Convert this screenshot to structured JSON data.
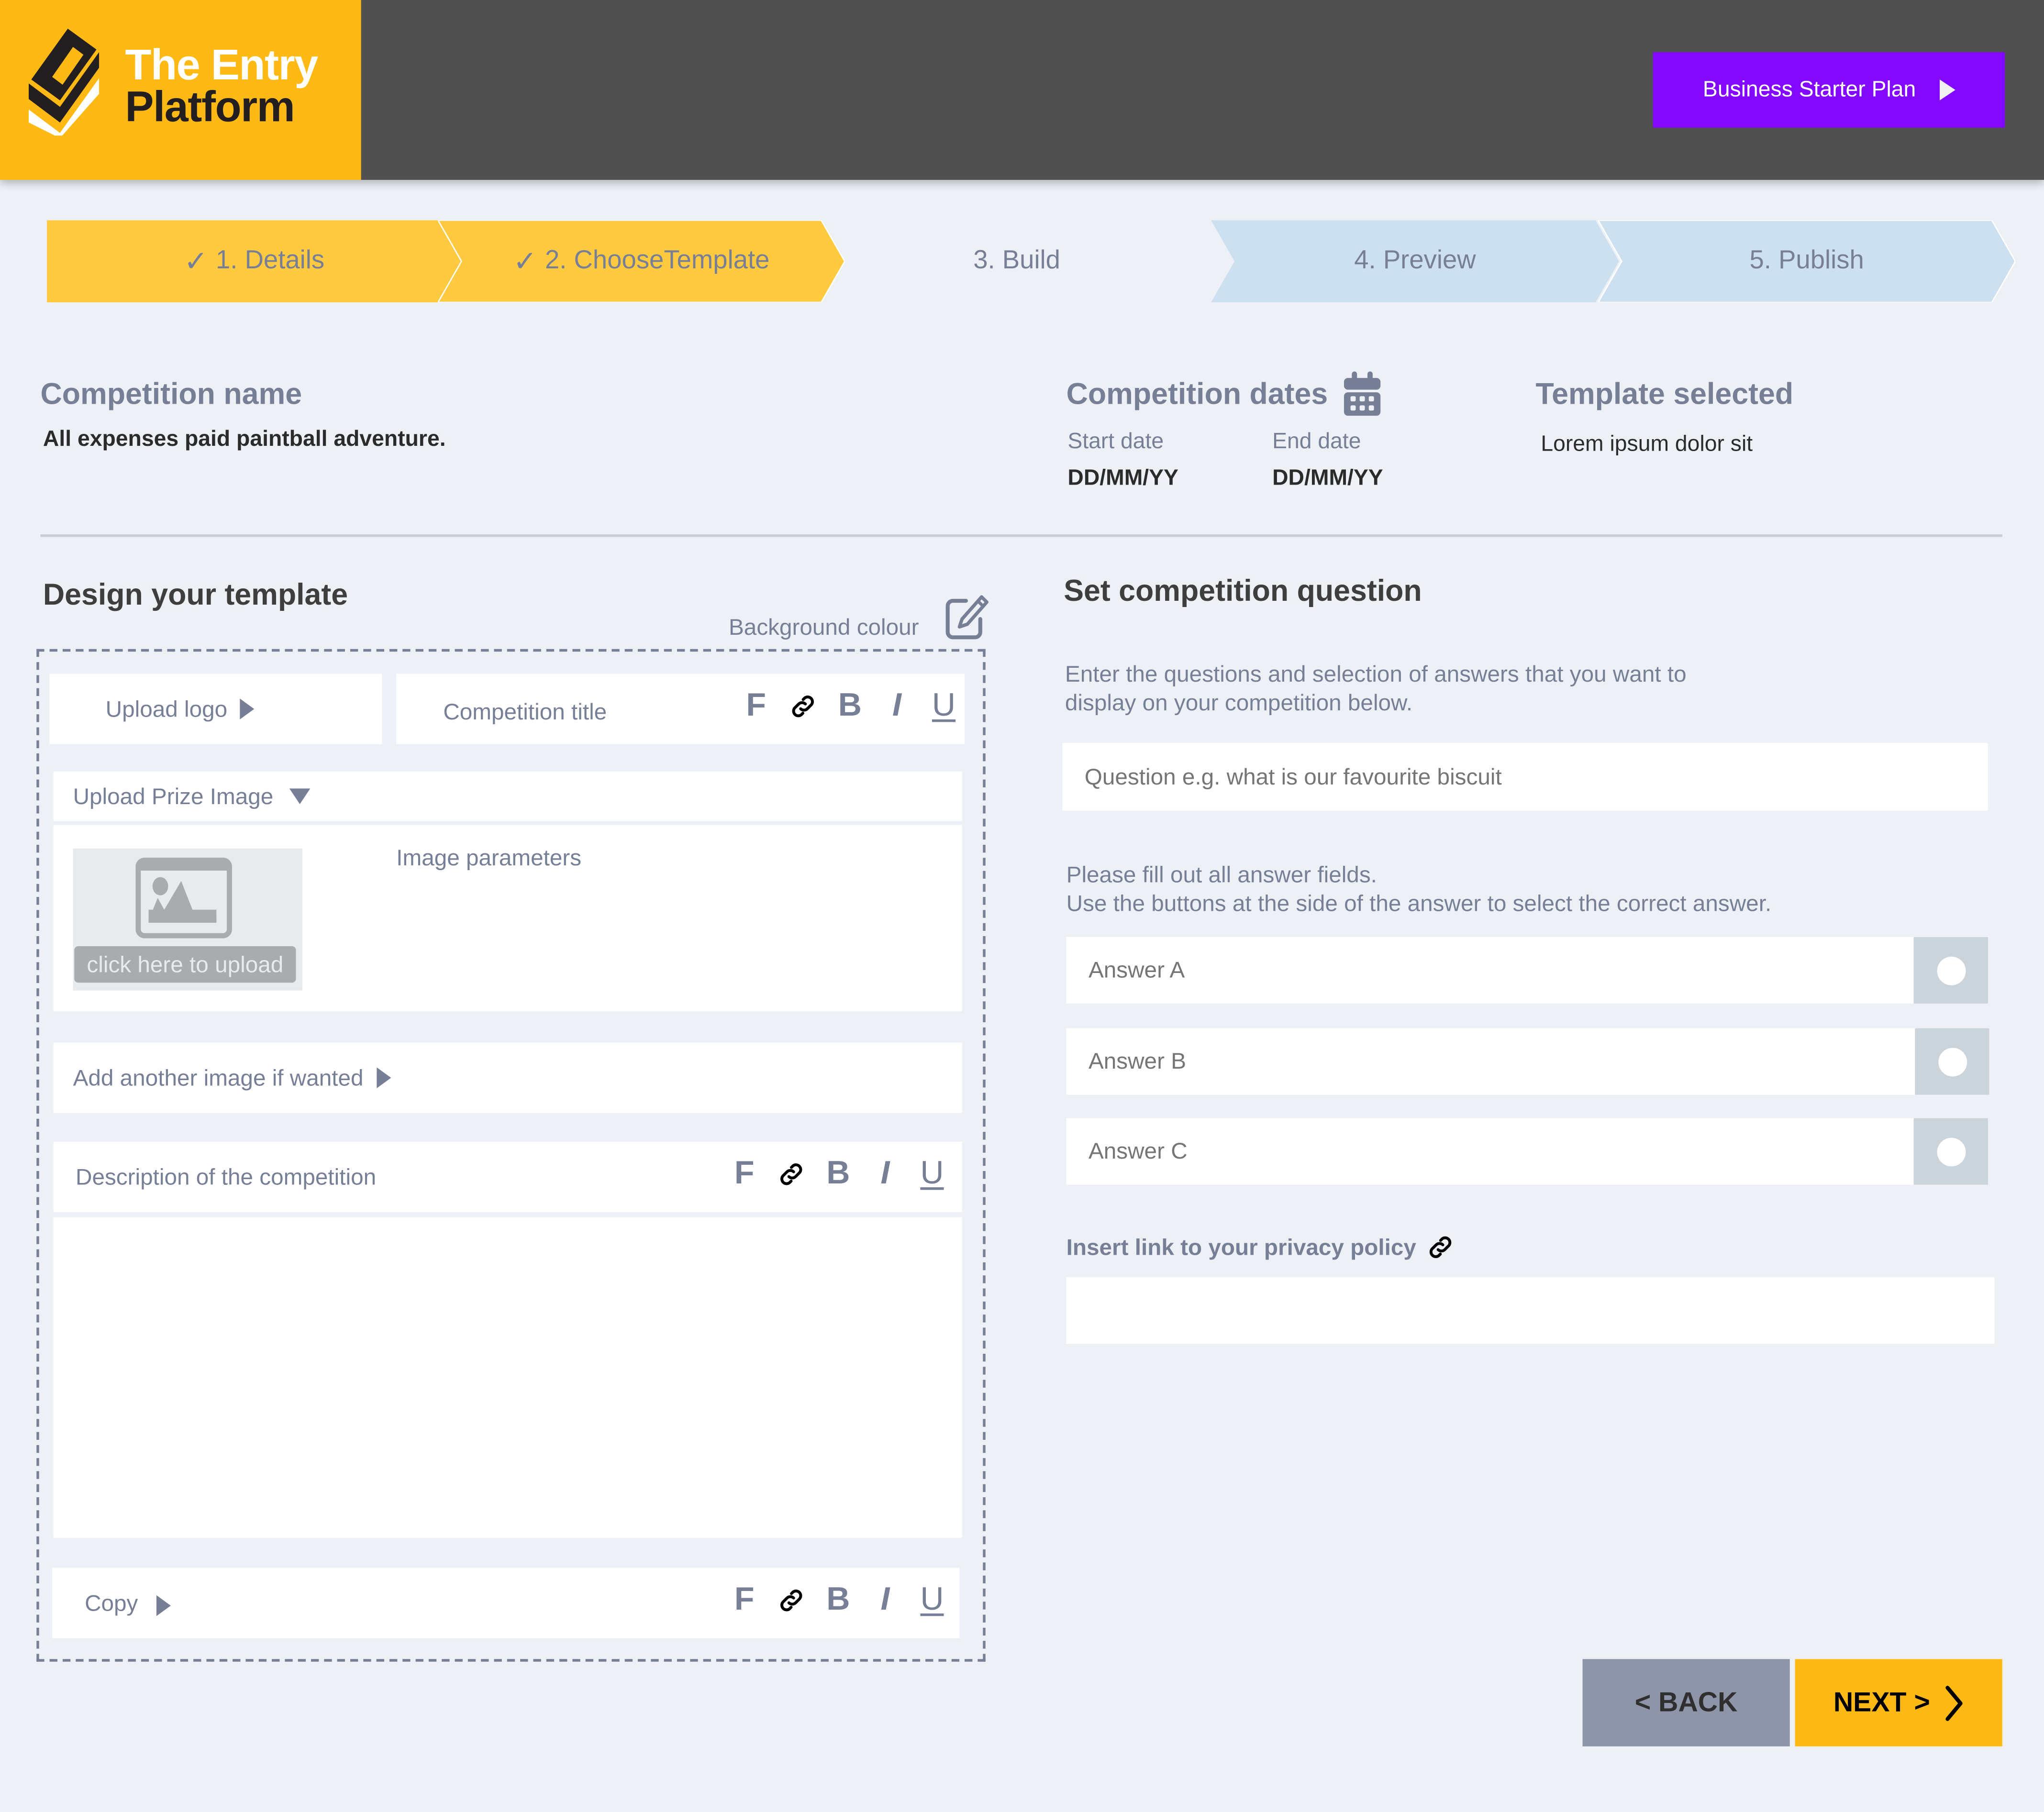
{
  "brand": {
    "name_line1": "The Entry",
    "name_line2": "Platform",
    "primary_color": "#ffb914",
    "header_color": "#505050"
  },
  "header": {
    "plan_button_label": "Business Starter Plan",
    "plan_button_color": "#8208ff"
  },
  "stepper": {
    "steps": [
      {
        "label": "1. Details",
        "state": "complete",
        "check": "✓"
      },
      {
        "label": "2. ChooseTemplate",
        "state": "complete",
        "check": "✓"
      },
      {
        "label": "3. Build",
        "state": "current"
      },
      {
        "label": "4. Preview",
        "state": "upcoming"
      },
      {
        "label": "5. Publish",
        "state": "upcoming"
      }
    ]
  },
  "summary": {
    "competition_name_heading": "Competition name",
    "competition_name_value": "All expenses paid paintball adventure.",
    "competition_dates_heading": "Competition dates",
    "start_date_label": "Start date",
    "start_date_value": "DD/MM/YY",
    "end_date_label": "End date",
    "end_date_value": "DD/MM/YY",
    "template_heading": "Template selected",
    "template_value": "Lorem ipsum dolor sit"
  },
  "design": {
    "heading": "Design your template",
    "background_colour_label": "Background colour",
    "upload_logo_label": "Upload logo",
    "competition_title_label": "Competition title",
    "upload_prize_image_label": "Upload Prize Image",
    "image_placeholder_caption": "click here to upload",
    "image_parameters_label": "Image parameters",
    "add_image_label": "Add another image if wanted",
    "description_label": "Description of the competition",
    "description_value": "",
    "copy_label": "Copy",
    "format_tools": {
      "font": "F",
      "bold": "B",
      "italic": "I",
      "underline": "U"
    }
  },
  "question": {
    "heading": "Set competition question",
    "intro_line1": "Enter the questions and selection of answers that you want to",
    "intro_line2": "display on your competition below.",
    "question_placeholder": "Question e.g. what is our favourite biscuit",
    "answers_help_line1": "Please fill out all answer fields.",
    "answers_help_line2": "Use the buttons at the side of the answer to select the correct answer.",
    "answers": [
      {
        "placeholder": "Answer A",
        "selected": false
      },
      {
        "placeholder": "Answer B",
        "selected": false
      },
      {
        "placeholder": "Answer C",
        "selected": false
      }
    ],
    "privacy_label": "Insert link to your privacy policy",
    "privacy_value": ""
  },
  "nav": {
    "back_label": "< BACK",
    "next_label": "NEXT >"
  }
}
